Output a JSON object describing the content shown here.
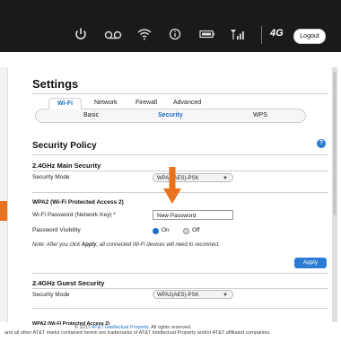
{
  "header": {
    "brand": "4G",
    "logout_label": "Logout",
    "icons": [
      "power-icon",
      "voicemail-icon",
      "wifi-icon",
      "info-icon",
      "battery-icon",
      "signal-bars-icon"
    ]
  },
  "page": {
    "title": "Settings",
    "tabs": [
      "Wi-Fi",
      "Network",
      "Firewall",
      "Advanced"
    ],
    "active_tab": "Wi-Fi",
    "subtabs": [
      "Basic",
      "Security",
      "WPS"
    ],
    "active_subtab": "Security"
  },
  "section": {
    "title": "Security Policy",
    "help_icon": "?"
  },
  "main_security": {
    "title": "2.4GHz Main Security",
    "mode_label": "Security Mode",
    "mode_value": "WPA2(AES)-PSK",
    "wpa_title": "WPA2 (Wi-Fi Protected Access 2)",
    "password_label": "Wi-Fi Password (Network Key) *",
    "password_value": "New Password",
    "visibility_label": "Password Visibility",
    "visibility_on": "On",
    "visibility_off": "Off",
    "visibility_selected": "On",
    "note_prefix": "Note: After you click ",
    "note_strong": "Apply",
    "note_suffix": ", all connected Wi-Fi devices will need to reconnect.",
    "apply_label": "Apply"
  },
  "guest_security": {
    "title": "2.4GHz Guest Security",
    "mode_label": "Security Mode",
    "mode_value": "WPA2(AES)-PSK",
    "clipped_title": "WPA2 (Wi-Fi Protected Access 2)"
  },
  "footer": {
    "copyright_prefix": "© 2017 ",
    "copyright_link": "AT&T Intellectual Property",
    "copyright_suffix": ". All rights reserved.",
    "trademark": "and all other AT&T marks contained herein are trademarks of AT&T Intellectual Property and/or AT&T affiliated companies."
  },
  "colors": {
    "accent": "#1a6fc2",
    "arrow": "#e8731c",
    "topbar": "#1a1a1a"
  }
}
